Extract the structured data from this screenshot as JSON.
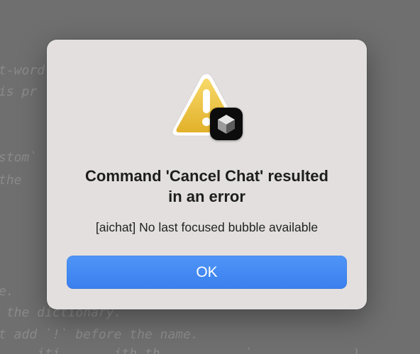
{
  "background_code": {
    "lines": [
      "t-word",
      "is pr",
      "stom`",
      "the",
      "e.",
      " the dictionary.",
      "t add `!` before the name.",
      "     iti       ith th           `             )"
    ]
  },
  "dialog": {
    "icon": "warning-triangle-icon",
    "badge_icon": "app-cube-icon",
    "title_line1": "Command 'Cancel Chat' resulted",
    "title_line2": "in an error",
    "message": "[aichat] No last focused bubble available",
    "ok_label": "OK"
  },
  "colors": {
    "dialog_bg": "#e3dfdf",
    "button_blue": "#3d82f0",
    "warning_yellow": "#f2c94c"
  }
}
